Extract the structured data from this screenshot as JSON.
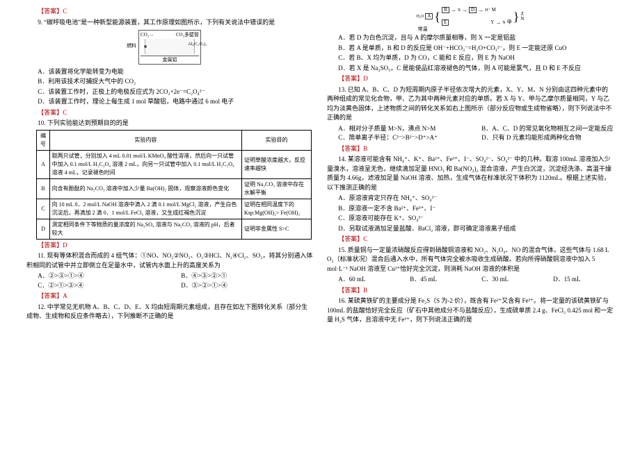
{
  "left": {
    "ans9pre": "【答案】C",
    "q9": "9. “碳呼吸电池”是一种新型能源装置，其工作原理如图所示，下列有关说法中错误的是",
    "battery": {
      "top_l": "CO₂→",
      "top_r": "CO₂多壁管",
      "side": "燃料",
      "r1": "Al₂(C₂O₄)₃",
      "bot": "金属铝"
    },
    "q9A": "A．该装置将化学能转变为电能",
    "q9B": "B．利用该技术可捕捉大气中的 CO₂",
    "q9C": "C．该装置工作时，正极上的电极反应式为 2CO₂+2e⁻=C₂O₄²⁻",
    "q9D": "D．该装置工作时，理论上每生成 1 mol 草酸铝，电路中通过 6 mol 电子",
    "ans9": "【答案】C",
    "q10": "10. 下列实验能达到预期目的的是",
    "th1": "编号",
    "th2": "实验内容",
    "th3": "实验目的",
    "rA_l": "A",
    "rA_c": "取两只试管，分别加入 4 mL 0.01 mol/L KMnO₄ 酸性溶液，然后向一只试管中加入 0.1 mol/L H₂C₂O₄ 溶液 2 mL，向另一只试管中加入 0.1 mol/L H₂C₂O₄ 溶液 4 mL，记录褪色时间",
    "rA_r": "证明草酸浓度越大，反应速率越快",
    "rB_l": "B",
    "rB_c": "向含有酚酞的 Na₂CO₃ 溶液中加入少量 Ba(OH)₂ 固体，观察溶液颜色变化",
    "rB_r": "证明 Na₂CO₃ 溶液中存在水解平衡",
    "rC_l": "C",
    "rC_c": "向 10 mL 0．2 mol/L NaOH 溶液中滴入 2 滴 0.1 mol/L MgCl₂ 溶液，产生白色沉淀后，再滴加 2 滴 0．1 mol/L FeCl₃ 溶液，又生成红褐色沉淀",
    "rC_r": "证明在相同温度下的 Ksp:Mg(OH)₂> Fe(OH)₃",
    "rD_l": "D",
    "rD_c": "测定相同条件下等物质的量浓度的 Na₂SO₄ 溶液与 Na₂CO₃ 溶液的 pH，后者较大",
    "rD_r": "证明非金属性 S>C",
    "ans10": "【答案】D",
    "q11": "11. 现有等体积混合而成的 4 组气体：①NO、NO₂②NO₂、O₂③HCl、N₂④Cl₂、SO₂，将其分别通入体积相同的试管中并立即倒立在足量水中，试管内水面上升的高度关系为",
    "q11A": "A．②>③>①>④",
    "q11B": "B．④>③>②>①",
    "q11C": "C．②>①>③>④",
    "q11D": "D．③>②>①>④",
    "ans11": "【答案】A",
    "q12": "12. 中学常见无机物 A、B、C、D、E、X 均由短周期元素组成，且存在如左下图转化关系（部分生成物、生成物和反应条件略去），下列推断不正确的是"
  },
  "right": {
    "flow": {
      "A_in": "H₂O",
      "A_sub": "常温",
      "A": "A",
      "B": "B",
      "E": "E",
      "X1": "X",
      "X2": "X",
      "D": "D",
      "Hp": "H⁺",
      "M": "M",
      "N1": "N",
      "jia": "甲",
      "Y": "Y",
      "Z": "Z",
      "N2": "N"
    },
    "q12A": "A．若 D 为白色沉淀，且与 A 的摩尔质量相等，则 X 一定是铝盐",
    "q12B": "B．若 A 是单质，B 和 D 的反应是 OH⁻+HCO₃⁻=H₂O+CO₃²⁻，则 E 一定能还原 CuO",
    "q12C": "C．若 B、X 均为单质，D 为 CO，C 能和 E 反应，则 E 为 NaOH",
    "q12D": "D．若 X 是 Na₂SO₃，C 是能使品红溶液褪色的气体，则 A 可能是氯气，且 D 和 E 不反应",
    "ans12": "【答案】D",
    "q13": "13. 已知 A、B、C、D 为短周期内原子半径依次增大的元素，X、Y、M、N 分别由这四种元素中的两种组成的常见化合物，甲、乙为其中两种元素对应的单质。若 X 与 Y、甲与乙摩尔质量相同，Y 与乙均为淡黄色固体，上述物质之间的转化关系如右上图所示（部分反应物或生成物省略），则下列说法中不正确的是",
    "q13A": "A．相对分子质量 M>N，沸点 N>M",
    "q13B": "B．A、C、D 的常见氧化物相互之间一定能反应",
    "q13C": "C．简单离子半径：C²⁻>B²⁻>D⁺>A⁺",
    "q13D": "D．只有 D 元素均能形成两种化合物",
    "ans13": "【答案】B",
    "q14": "14. 某溶液可能含有 NH₄⁺、K⁺、Ba²⁺、Fe³⁺、I⁻、SO₄²⁻、SO₄²⁻ 中的几种。取溶 100mL 溶液加入少量溴水，溶液呈无色，继续滴加足量 HNO₃ 和 Ba(NO₃)₂ 混合溶液，产生白沉淀，沉淀经洗涤、高温干燥质量为 4.66g，滤液加足量 NaOH 溶液、加热，生成气体在标准状况下体积为 1120mL。根据上述实验，以下推测正确的是",
    "q14A": "A．原溶液肯定只存在 NH₄⁺、SO₄²⁻",
    "q14B": "B．原溶液一定不含 Ba²⁺、Fe³⁺、I⁻",
    "q14C": "C．原溶液可能存在 K⁺、SO₄²⁻",
    "q14D": "D．另取试液滴加足量盐酸、BaCl₂ 溶液，即可确定溶液离子组成",
    "ans14": "【答案】C",
    "q15": "15. 质量铜与一定量浓硝酸反应得到硝酸铜溶液和 NO₂、N₂O₄、NO 的混合气体，这些气体与 1.68 L O₂（标准状况）混合后通入水中，所有气体完全被水吸收生成硝酸。若向所得硝酸铜溶液中加入 5 mol·L⁻¹ NaOH 溶液至 Cu²⁺恰好完全沉淀，则消耗 NaOH 溶液的体积是",
    "q15A": "A．60 mL",
    "q15B": "B．45 mL",
    "q15C": "C．30 mL",
    "q15D": "D．15 mL",
    "ans15": "【答案】B",
    "q16": "16. 某硫黄铁矿的主要成分是 Fe₂S（S 为-2 价），既含有 Fe²⁺又含有 Fe³⁺。将一定量的该硫黄铁矿与 100mL 的盐酸恰好完全反应（矿石中其他成分不与盐酸反应），生成硫单质 2.4 g、FeCl₂ 0.425 mol 和一定量 H₂S 气体，且溶液中无 Fe³⁺，则下列说法正确的是"
  }
}
